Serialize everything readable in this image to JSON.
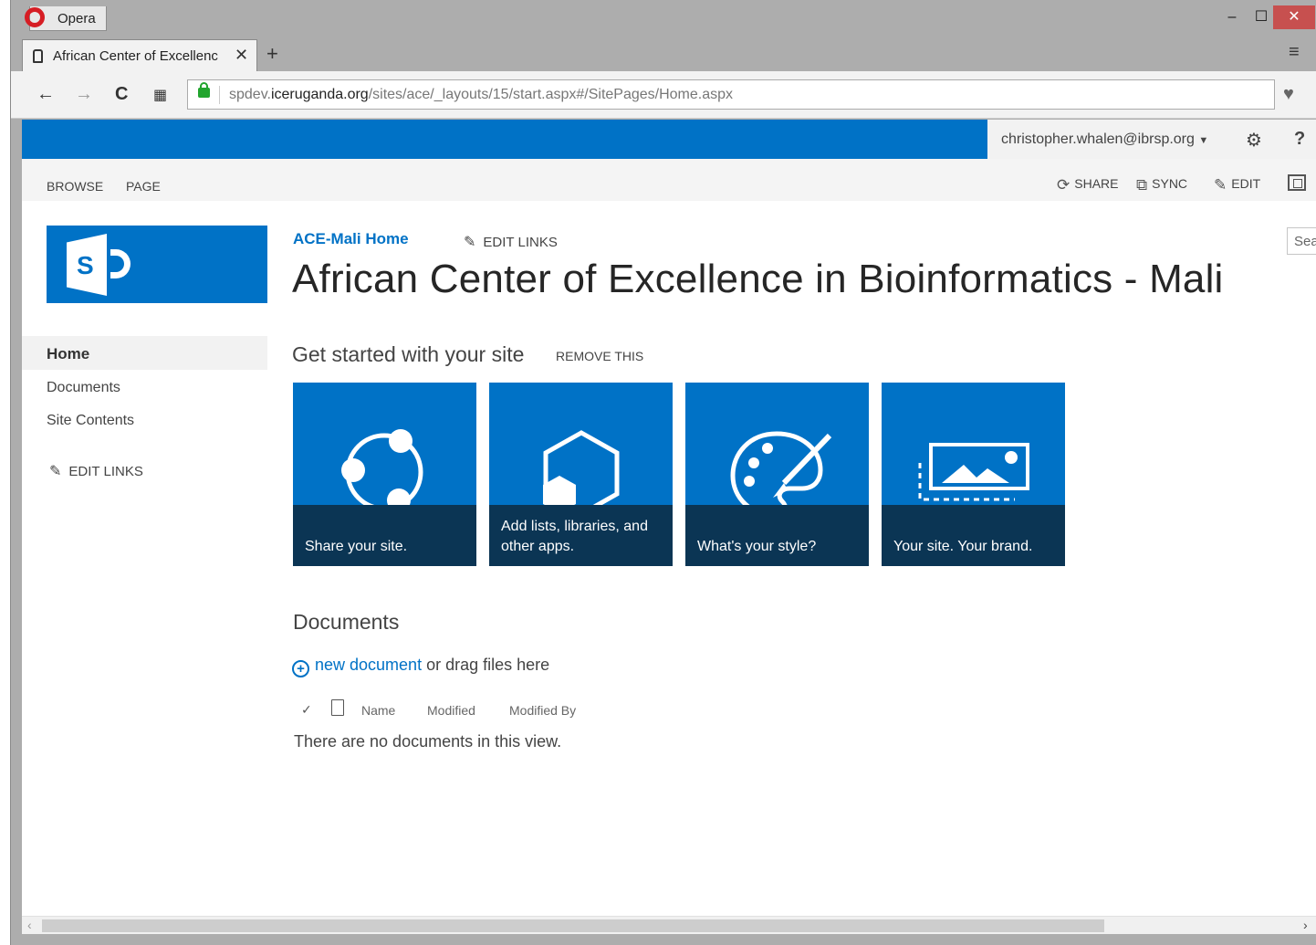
{
  "browser": {
    "app_name": "Opera",
    "tab_title": "African Center of Excellenc",
    "tab_close": "✕",
    "new_tab": "+",
    "url_prefix": "spdev.",
    "url_domain": "iceruganda.org",
    "url_path": "/sites/ace/_layouts/15/start.aspx#/SitePages/Home.aspx",
    "window_min": "‒",
    "window_max": "☐",
    "window_close": "✕"
  },
  "suite": {
    "user": "christopher.whalen@ibrsp.org",
    "help": "?"
  },
  "ribbon": {
    "browse": "BROWSE",
    "page": "PAGE",
    "share": "SHARE",
    "sync": "SYNC",
    "edit": "EDIT"
  },
  "search": {
    "placeholder": "Sea"
  },
  "site": {
    "breadcrumb": "ACE-Mali Home",
    "edit_links": "EDIT LINKS",
    "title": "African Center of Excellence in Bioinformatics - Mali"
  },
  "left_nav": {
    "home": "Home",
    "documents": "Documents",
    "site_contents": "Site Contents",
    "edit_links": "EDIT LINKS"
  },
  "get_started": {
    "title": "Get started with your site",
    "remove": "REMOVE THIS",
    "tiles": [
      {
        "label": "Share your site.",
        "icon": "share-icon"
      },
      {
        "label": "Add lists, libraries, and other apps.",
        "icon": "add-apps-icon"
      },
      {
        "label": "What's your style?",
        "icon": "palette-icon"
      },
      {
        "label": "Your site. Your brand.",
        "icon": "brand-image-icon"
      }
    ]
  },
  "documents": {
    "title": "Documents",
    "new_document": "new document",
    "drag_text": " or drag files here",
    "columns": [
      "Name",
      "Modified",
      "Modified By"
    ],
    "empty_message": "There are no documents in this view."
  },
  "colors": {
    "sharepoint_blue": "#0072c6",
    "tile_caption": "#0b3554",
    "opera_red": "#d61d24",
    "window_chrome": "#adadad"
  }
}
